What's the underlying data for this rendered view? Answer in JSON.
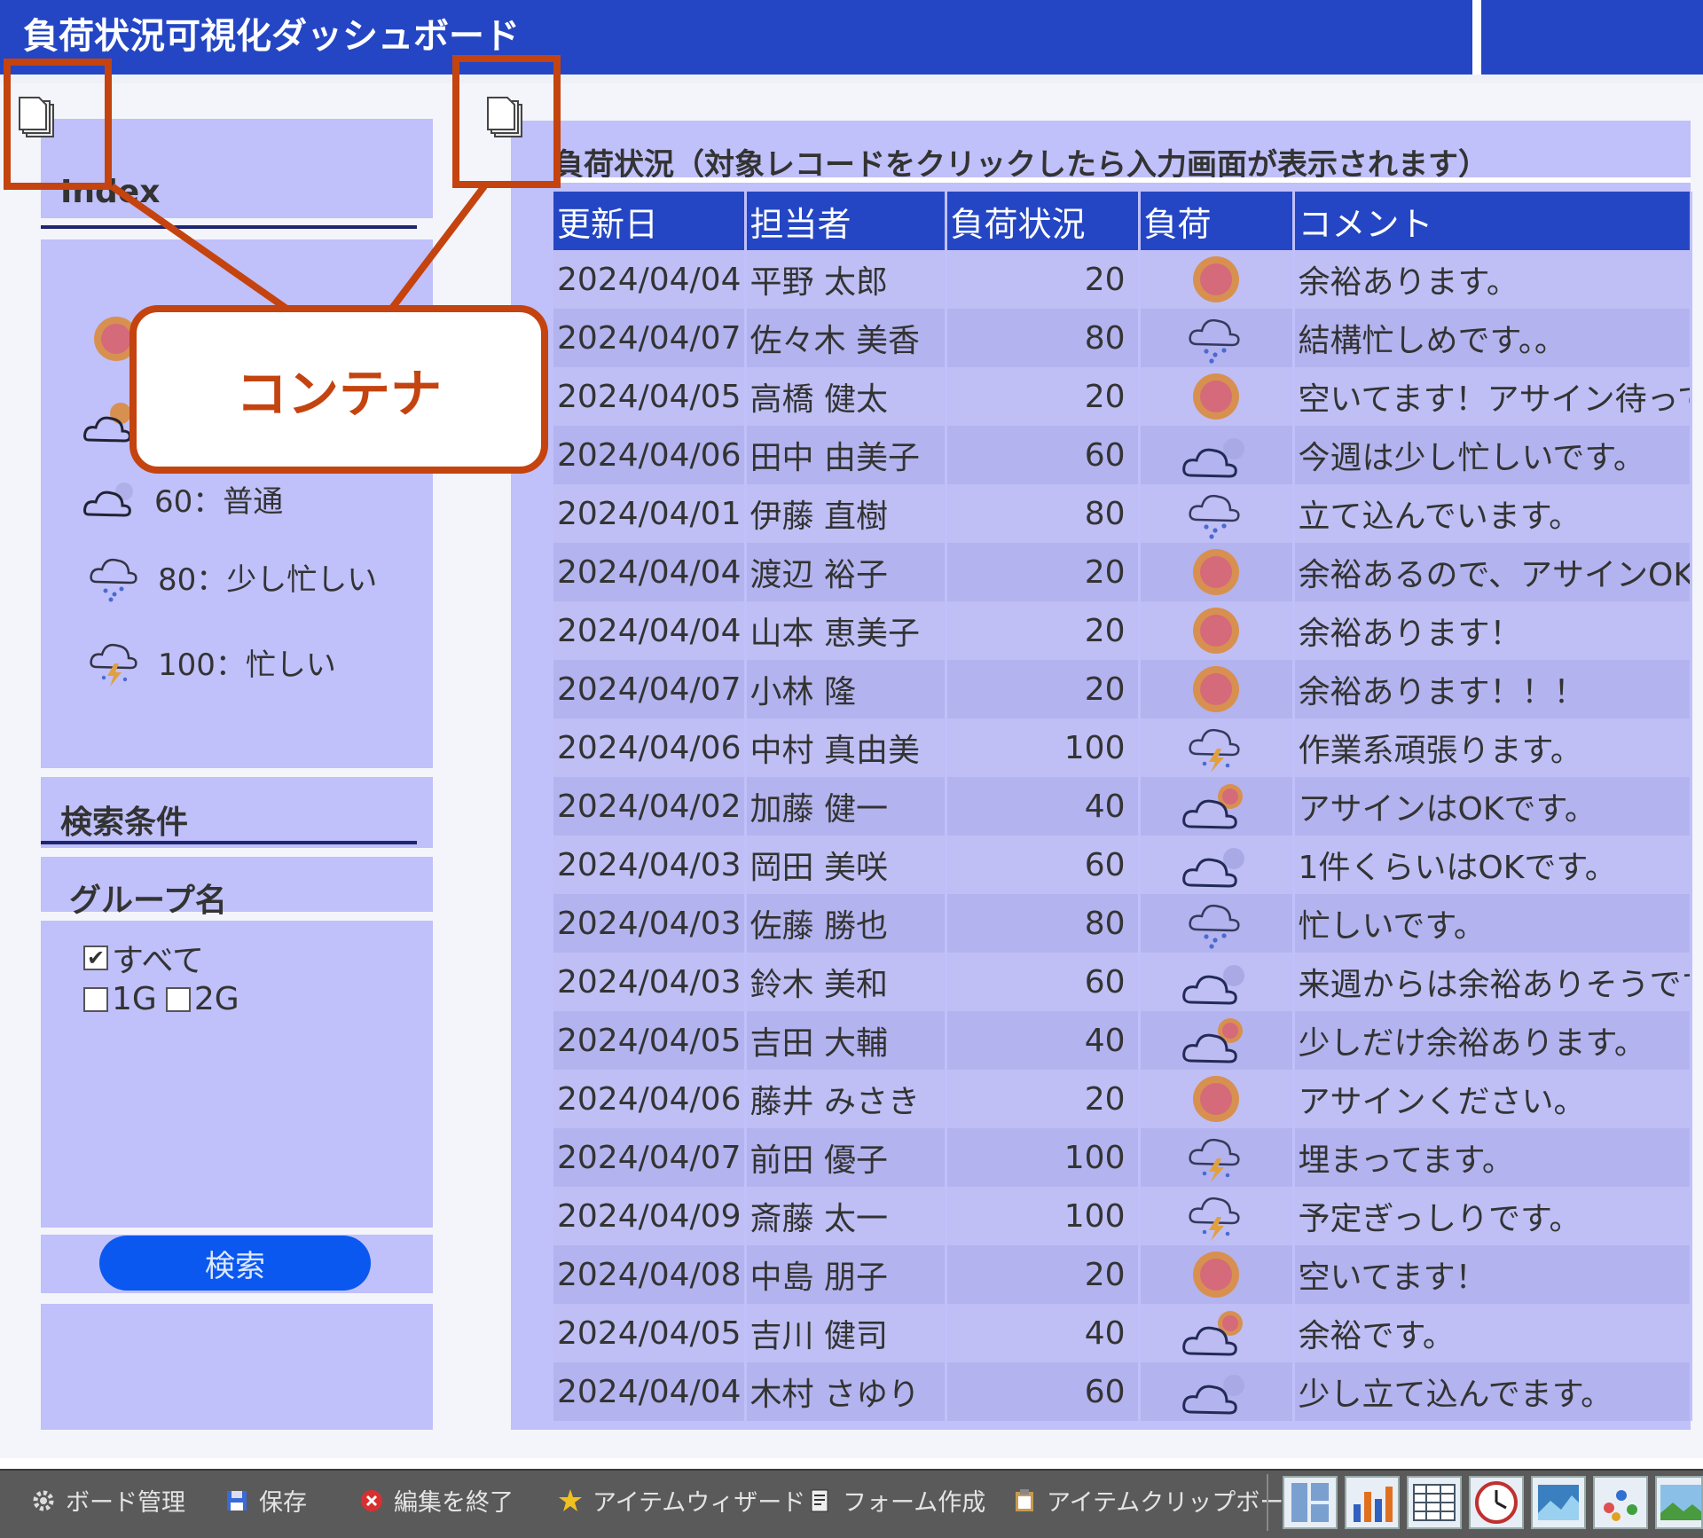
{
  "app": {
    "title": "負荷状況可視化ダッシュボード"
  },
  "annotation": {
    "callout_label": "コンテナ"
  },
  "sidebar": {
    "index_heading": "Index",
    "legend": [
      {
        "icon": "sun-icon",
        "label": ""
      },
      {
        "icon": "sun-cloud-icon",
        "label": ""
      },
      {
        "icon": "cloud-icon",
        "label": "60：普通"
      },
      {
        "icon": "rain-cloud-icon",
        "label": "80：少し忙しい"
      },
      {
        "icon": "thunder-cloud-icon",
        "label": "100：忙しい"
      }
    ],
    "search_heading": "検索条件",
    "group_label": "グループ名",
    "checkboxes": [
      {
        "label": "すべて",
        "checked": true
      },
      {
        "label": "1G",
        "checked": false
      },
      {
        "label": "2G",
        "checked": false
      }
    ],
    "search_button": "検索"
  },
  "table": {
    "caption": "負荷状況（対象レコードをクリックしたら入力画面が表示されます）",
    "columns": [
      "更新日",
      "担当者",
      "負荷状況",
      "負荷",
      "コメント"
    ],
    "rows": [
      {
        "date": "2024/04/04",
        "person": "平野 太郎",
        "load": "20",
        "icon": "sun",
        "comment": "余裕あります。"
      },
      {
        "date": "2024/04/07",
        "person": "佐々木 美香",
        "load": "80",
        "icon": "rain",
        "comment": "結構忙しめです。。"
      },
      {
        "date": "2024/04/05",
        "person": "高橋 健太",
        "load": "20",
        "icon": "sun",
        "comment": "空いてます！アサイン待ってま"
      },
      {
        "date": "2024/04/06",
        "person": "田中 由美子",
        "load": "60",
        "icon": "cloud",
        "comment": "今週は少し忙しいです。"
      },
      {
        "date": "2024/04/01",
        "person": "伊藤 直樹",
        "load": "80",
        "icon": "rain",
        "comment": "立て込んでいます。"
      },
      {
        "date": "2024/04/04",
        "person": "渡辺 裕子",
        "load": "20",
        "icon": "sun",
        "comment": "余裕あるので、アサインOKで"
      },
      {
        "date": "2024/04/04",
        "person": "山本 恵美子",
        "load": "20",
        "icon": "sun",
        "comment": "余裕あります！"
      },
      {
        "date": "2024/04/07",
        "person": "小林 隆",
        "load": "20",
        "icon": "sun",
        "comment": "余裕あります！！！"
      },
      {
        "date": "2024/04/06",
        "person": "中村 真由美",
        "load": "100",
        "icon": "thunder",
        "comment": "作業系頑張ります。"
      },
      {
        "date": "2024/04/02",
        "person": "加藤 健一",
        "load": "40",
        "icon": "suncloud",
        "comment": "アサインはOKです。"
      },
      {
        "date": "2024/04/03",
        "person": "岡田 美咲",
        "load": "60",
        "icon": "cloud",
        "comment": "1件くらいはOKです。"
      },
      {
        "date": "2024/04/03",
        "person": "佐藤 勝也",
        "load": "80",
        "icon": "rain",
        "comment": "忙しいです。"
      },
      {
        "date": "2024/04/03",
        "person": "鈴木 美和",
        "load": "60",
        "icon": "cloud",
        "comment": "来週からは余裕ありそうです。"
      },
      {
        "date": "2024/04/05",
        "person": "吉田 大輔",
        "load": "40",
        "icon": "suncloud",
        "comment": "少しだけ余裕あります。"
      },
      {
        "date": "2024/04/06",
        "person": "藤井 みさき",
        "load": "20",
        "icon": "sun",
        "comment": "アサインください。"
      },
      {
        "date": "2024/04/07",
        "person": "前田 優子",
        "load": "100",
        "icon": "thunder",
        "comment": "埋まってます。"
      },
      {
        "date": "2024/04/09",
        "person": "斎藤 太一",
        "load": "100",
        "icon": "thunder",
        "comment": "予定ぎっしりです。"
      },
      {
        "date": "2024/04/08",
        "person": "中島 朋子",
        "load": "20",
        "icon": "sun",
        "comment": "空いてます！"
      },
      {
        "date": "2024/04/05",
        "person": "吉川 健司",
        "load": "40",
        "icon": "suncloud",
        "comment": "余裕です。"
      },
      {
        "date": "2024/04/04",
        "person": "木村 さゆり",
        "load": "60",
        "icon": "cloud",
        "comment": "少し立て込んでます。"
      }
    ]
  },
  "toolbar": {
    "items": [
      {
        "icon": "gear-icon",
        "label": "ボード管理"
      },
      {
        "icon": "save-icon",
        "label": "保存"
      },
      {
        "icon": "close-icon",
        "label": "編集を終了"
      },
      {
        "icon": "wizard-icon",
        "label": "アイテムウィザード"
      },
      {
        "icon": "form-icon",
        "label": "フォーム作成"
      },
      {
        "icon": "clipboard-icon",
        "label": "アイテムクリップボード"
      }
    ],
    "widget_buttons": [
      "layout-icon",
      "bar-chart-icon",
      "table-icon",
      "clock-icon",
      "image-chart-icon",
      "scatter-icon",
      "picture-icon"
    ]
  },
  "colors": {
    "header": "#2446c4",
    "panel": "#c0c0fa",
    "accent_button": "#0a58f0",
    "annotation": "#c4430f"
  }
}
